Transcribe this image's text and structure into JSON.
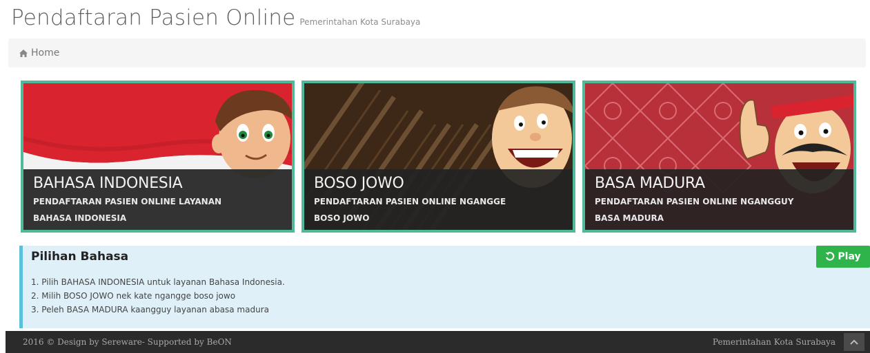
{
  "header": {
    "title": "Pendaftaran Pasien Online",
    "subtitle": "Pemerintahan Kota Surabaya"
  },
  "breadcrumb": {
    "icon": "home-icon",
    "home_label": "Home"
  },
  "cards": [
    {
      "name": "BAHASA INDONESIA",
      "desc_line1": "PENDAFTARAN PASIEN ONLINE LAYANAN",
      "desc_line2": "BAHASA INDONESIA",
      "theme_color": "#d9232e"
    },
    {
      "name": "BOSO JOWO",
      "desc_line1": "PENDAFTARAN PASIEN ONLINE NGANGGE",
      "desc_line2": "BOSO JOWO",
      "theme_color": "#4a2f1c"
    },
    {
      "name": "BASA MADURA",
      "desc_line1": "PENDAFTARAN PASIEN ONLINE NGANGGUY",
      "desc_line2": "BASA MADURA",
      "theme_color": "#c0303b"
    }
  ],
  "card_border_color": "#4fb99a",
  "info": {
    "title": "Pilihan Bahasa",
    "steps": [
      "1. Pilih BAHASA INDONESIA untuk layanan Bahasa Indonesia.",
      "2. Milih BOSO JOWO nek kate ngangge boso jowo",
      "3. Peleh BASA MADURA kaangguy layanan abasa madura"
    ]
  },
  "play_button": {
    "label": "Play",
    "icon": "replay-icon",
    "color": "#2eb44a"
  },
  "footer": {
    "left": "2016 © Design by Sereware- Supported by BeON",
    "right": "Pemerintahan Kota Surabaya",
    "scroll_top_icon": "chevron-up-icon"
  }
}
